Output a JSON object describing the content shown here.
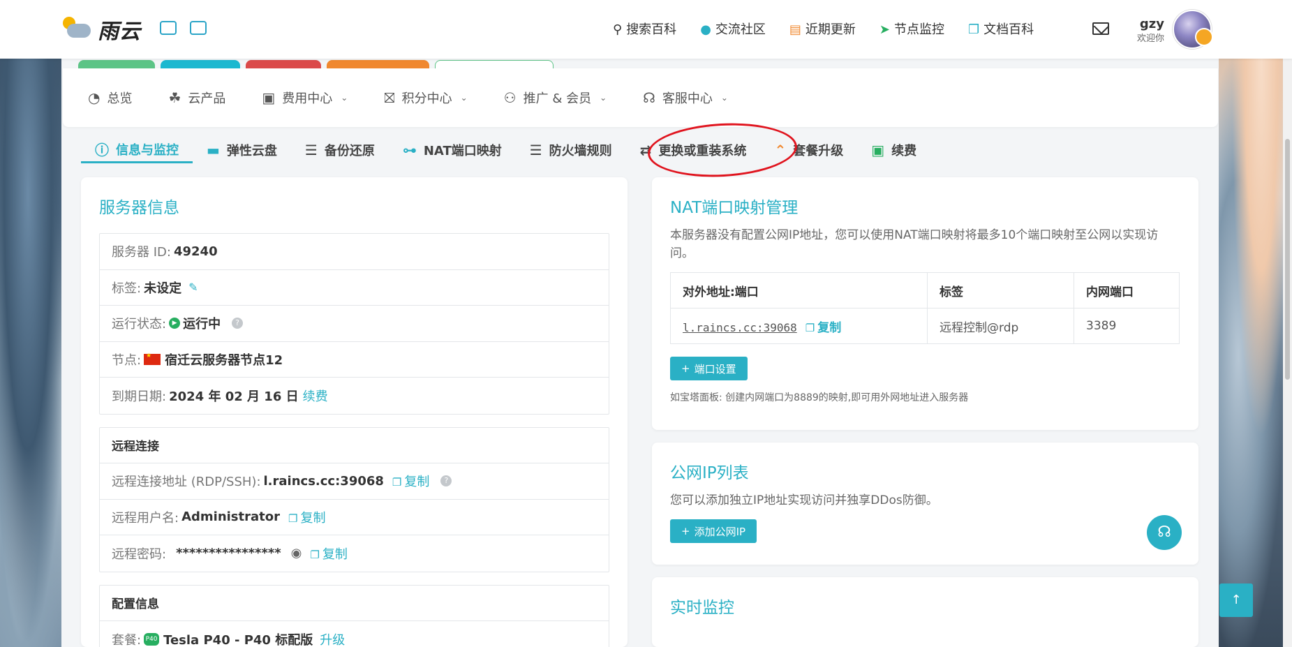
{
  "header": {
    "logo_text": "雨云",
    "nav": [
      {
        "icon": "search-icon",
        "label": "搜索百科"
      },
      {
        "icon": "bell-icon",
        "label": "交流社区"
      },
      {
        "icon": "news-icon",
        "label": "近期更新"
      },
      {
        "icon": "location-arrow-icon",
        "label": "节点监控"
      },
      {
        "icon": "book-icon",
        "label": "文档百科"
      }
    ],
    "user": {
      "name": "gzy",
      "welcome": "欢迎你"
    }
  },
  "colors": {
    "accent": "#2ab0c5",
    "strip1": "#5cc486",
    "strip2": "#1cb8d0",
    "strip3": "#db4a4a",
    "strip4": "#f0882f",
    "strip5": "#ffffff",
    "annotation": "#e0141e"
  },
  "menu": [
    {
      "icon": "dashboard-icon",
      "label": "总览",
      "dropdown": false
    },
    {
      "icon": "cubes-icon",
      "label": "云产品",
      "dropdown": false
    },
    {
      "icon": "money-icon",
      "label": "费用中心",
      "dropdown": true
    },
    {
      "icon": "gift-icon",
      "label": "积分中心",
      "dropdown": true
    },
    {
      "icon": "users-icon",
      "label": "推广 & 会员",
      "dropdown": true
    },
    {
      "icon": "headset-icon",
      "label": "客服中心",
      "dropdown": true
    }
  ],
  "tabs": [
    {
      "icon": "info-icon",
      "label": "信息与监控",
      "active": true
    },
    {
      "icon": "disk-icon",
      "label": "弹性云盘"
    },
    {
      "icon": "server-icon",
      "label": "备份还原"
    },
    {
      "icon": "network-icon",
      "label": "NAT端口映射"
    },
    {
      "icon": "list-icon",
      "label": "防火墙规则"
    },
    {
      "icon": "exchange-icon",
      "label": "更换或重装系统"
    },
    {
      "icon": "upgrade-icon",
      "label": "套餐升级"
    },
    {
      "icon": "money-icon",
      "label": "续费"
    }
  ],
  "server_info": {
    "title": "服务器信息",
    "id_label": "服务器 ID:",
    "id_value": "49240",
    "tag_label": "标签:",
    "tag_value": "未设定",
    "status_label": "运行状态:",
    "status_value": "运行中",
    "node_label": "节点:",
    "node_value": "宿迁云服务器节点12",
    "expire_label": "到期日期:",
    "expire_value": "2024 年 02 月 16 日",
    "renew_link": "续费",
    "remote_header": "远程连接",
    "remote_addr_label": "远程连接地址 (RDP/SSH):",
    "remote_addr_value": "l.raincs.cc:39068",
    "remote_user_label": "远程用户名:",
    "remote_user_value": "Administrator",
    "remote_pass_label": "远程密码:",
    "remote_pass_value": "****************",
    "copy_label": "复制",
    "config_header": "配置信息",
    "plan_label": "套餐:",
    "plan_badge": "P40",
    "plan_value": "Tesla P40 - P40 标配版",
    "upgrade_link": "升级"
  },
  "nat": {
    "title": "NAT端口映射管理",
    "desc": "本服务器没有配置公网IP地址，您可以使用NAT端口映射将最多10个端口映射至公网以实现访问。",
    "columns": [
      "对外地址:端口",
      "标签",
      "内网端口"
    ],
    "rows": [
      {
        "addr": "l.raincs.cc:39068",
        "copy": "复制",
        "tag": "远程控制@rdp",
        "port": "3389"
      }
    ],
    "button": "端口设置",
    "hint": "如宝塔面板: 创建内网端口为8889的映射,即可用外网地址进入服务器"
  },
  "public_ip": {
    "title": "公网IP列表",
    "desc": "您可以添加独立IP地址实现访问并独享DDos防御。",
    "button": "添加公网IP"
  },
  "monitor": {
    "title": "实时监控"
  }
}
